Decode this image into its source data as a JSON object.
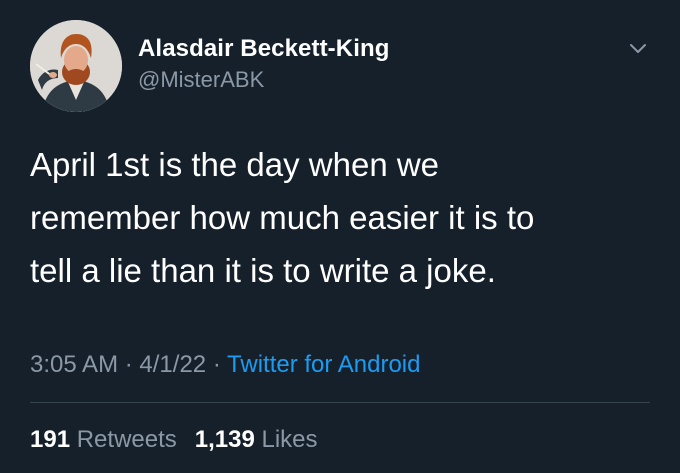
{
  "author": {
    "display_name": "Alasdair Beckett-King",
    "handle": "@MisterABK",
    "avatar_icon": "profile-photo"
  },
  "menu": {
    "icon": "chevron-down-icon"
  },
  "tweet": {
    "lines": [
      "April 1st is the day when we",
      "remember how much easier it is to",
      "tell a lie than it is to write a joke."
    ]
  },
  "meta": {
    "time": "3:05 AM",
    "separator": "·",
    "date": "4/1/22",
    "source": "Twitter for Android"
  },
  "stats": {
    "retweets_count": "191",
    "retweets_label": "Retweets",
    "likes_count": "1,139",
    "likes_label": "Likes"
  },
  "colors": {
    "background": "#15202b",
    "primary_text": "#ffffff",
    "secondary_text": "#8b98a5",
    "link": "#1d9bf0",
    "divider": "#38444d"
  }
}
